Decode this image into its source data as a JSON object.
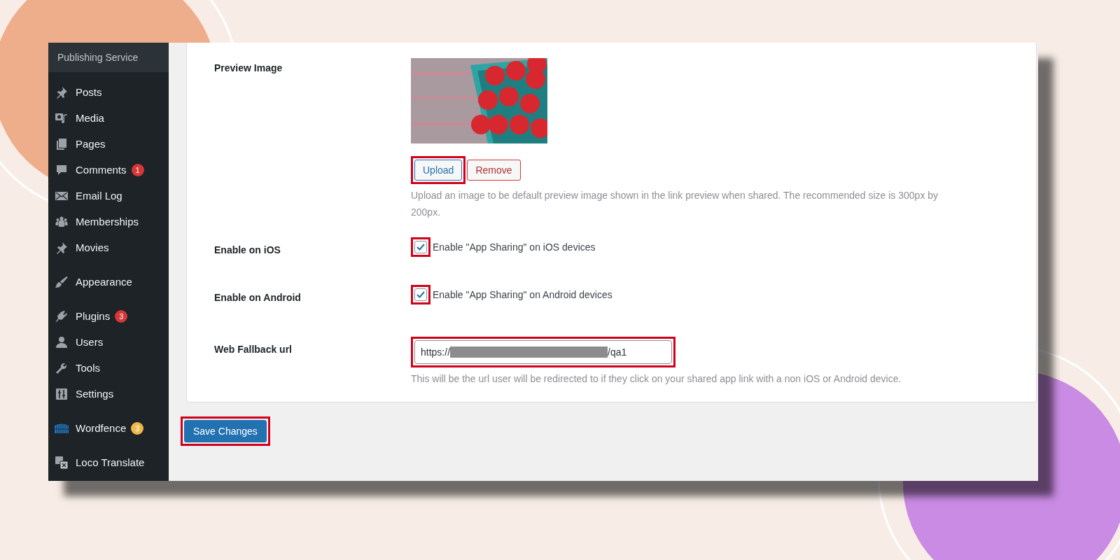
{
  "sidebar": {
    "site_title": "Publishing Service",
    "items": [
      {
        "label": "Posts",
        "separator_before": false
      },
      {
        "label": "Media",
        "separator_before": false
      },
      {
        "label": "Pages",
        "separator_before": false
      },
      {
        "label": "Comments",
        "separator_before": false,
        "badge": {
          "count": "1",
          "color": "#d63638"
        }
      },
      {
        "label": "Email Log",
        "separator_before": false
      },
      {
        "label": "Memberships",
        "separator_before": false
      },
      {
        "label": "Movies",
        "separator_before": false
      },
      {
        "label": "Appearance",
        "separator_before": true
      },
      {
        "label": "Plugins",
        "separator_before": true,
        "badge": {
          "count": "3",
          "color": "#d63638"
        }
      },
      {
        "label": "Users",
        "separator_before": false
      },
      {
        "label": "Tools",
        "separator_before": false
      },
      {
        "label": "Settings",
        "separator_before": false
      },
      {
        "label": "Wordfence",
        "separator_before": true,
        "badge": {
          "count": "3",
          "color": "#f0b849"
        }
      },
      {
        "label": "Loco Translate",
        "separator_before": true
      }
    ]
  },
  "settings": [
    {
      "label": "Preview Image",
      "buttons": [
        {
          "label": "Upload",
          "highlighted": true
        },
        {
          "label": "Remove",
          "highlighted": false
        }
      ],
      "help": "Upload an image to be default preview image shown in the link preview when shared. The recommended size is 300px by 200px."
    },
    {
      "kind": "checkbox",
      "label": "Enable on iOS",
      "checked": true,
      "highlighted": true,
      "text": "Enable \"App Sharing\" on iOS devices"
    },
    {
      "kind": "checkbox",
      "label": "Enable on Android",
      "checked": true,
      "highlighted": true,
      "text": "Enable \"App Sharing\" on Android devices"
    },
    {
      "kind": "url",
      "label": "Web Fallback url",
      "value_start": "https://",
      "value_end": "/qa1",
      "highlighted": true,
      "help": "This will be the url user will be redirected to if they click on your shared app link with a non iOS or Android device."
    }
  ],
  "save_button": {
    "label": "Save Changes",
    "highlighted": true
  }
}
